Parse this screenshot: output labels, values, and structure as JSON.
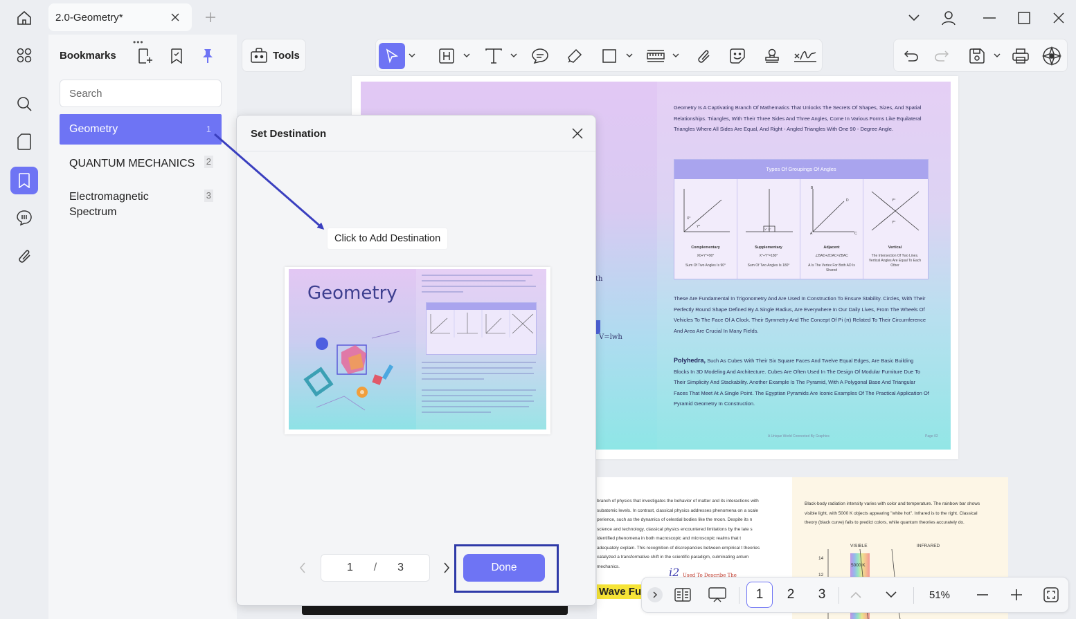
{
  "window": {
    "tab_title": "2.0-Geometry*"
  },
  "bookmarks": {
    "title": "Bookmarks",
    "search_placeholder": "Search",
    "items": [
      {
        "label": "Geometry",
        "page": "1",
        "selected": true
      },
      {
        "label": "QUANTUM MECHANICS",
        "page": "2",
        "selected": false
      },
      {
        "label": "Electromagnetic",
        "label2": "Spectrum",
        "page": "3",
        "selected": false
      }
    ]
  },
  "toolbar": {
    "tools_label": "Tools"
  },
  "dialog": {
    "title": "Set Destination",
    "tooltip": "Click to Add Destination",
    "current_page": "1",
    "separator": "/",
    "total_pages": "3",
    "done_label": "Done",
    "preview": {
      "title": "Geometry"
    }
  },
  "document": {
    "page1": {
      "intro": "Geometry Is A Captivating Branch Of Mathematics That Unlocks The Secrets Of Shapes, Sizes, And Spatial Relationships. Triangles, With Their Three Sides And Three Angles, Come In Various Forms Like Equilateral Triangles Where All Sides Are Equal, And Right - Angled Triangles With One 90 - Degree Angle.",
      "table_title": "Types Of Groupings Of Angles",
      "angles": [
        {
          "name": "Complementary",
          "desc": "X0+Y°=90°",
          "desc2": "Sum Of Two Angles Is 90°"
        },
        {
          "name": "Supplementary",
          "desc": "X°+Y°=180°",
          "desc2": "Sum Of Two Angles Is 180°"
        },
        {
          "name": "Adjacent",
          "desc": "∠BAD+ZDAC=ZBAC",
          "desc2": "A Is The Vertex For Both AD Is Shared"
        },
        {
          "name": "Vertical",
          "desc": "The Intersection Of Two Lines. Vertical Angles Are Equal To Each Other",
          "desc2": ""
        }
      ],
      "para2": "These Are Fundamental In Trigonometry And Are Used In Construction To Ensure Stability. Circles, With Their Perfectly Round Shape Defined By A Single Radius, Are Everywhere In Our Daily Lives, From The Wheels Of Vehicles To The Face Of A Clock. Their Symmetry And The Concept Of Pi (π) Related To Their Circumference And Area Are Crucial In Many Fields.",
      "poly_bold": "Polyhedra,",
      "para3": " Such As Cubes With Their Six Square Faces And Twelve Equal Edges, Are Basic Building Blocks In 3D Modeling And Architecture. Cubes Are Often Used In The Design Of Modular Furniture Due To Their Simplicity And Stackability. Another Example Is The Pyramid, With A Polygonal Base And Triangular Faces That Meet At A Single Point. The Egyptian Pyramids Are Iconic Examples Of The Practical Application Of Pyramid Geometry In Construction.",
      "footer_left": "A Unique World Connected By Graphics",
      "footer_right": "Page 02",
      "behind_text_1": "th",
      "behind_text_2": "V=lwh"
    },
    "page2": {
      "left_text": "branch of physics that investigates the behavior of matter and its interactions with subatomic levels. In contrast, classical physics addresses phenomena on a scale perience, such as the dynamics of celestial bodies like the moon. Despite its n science and technology, classical physics encountered limitations by the late s identified phenomena in both macroscopic and microscopic realms that t adequately explain. This recognition of discrepancies between empirical t theories catalyzed a transformative shift in the scientific paradigm, culminating antum mechanics.",
      "right_text": "Black-body radiation intensity varies with color and temperature. The rainbow bar shows visible light, with 5000 K objects appearing \"white hot\". Infrared is to the right. Classical theory (black curve) fails to predict colors, while quantum theories accurately do.",
      "visible": "VISIBLE",
      "infrared": "INFRARED",
      "k5000": "5000 K",
      "tick14": "14",
      "tick12": "12",
      "i2": "i2",
      "used": "Used To Describe The",
      "wave_tag": "Wave Fur"
    }
  },
  "pagenav": {
    "pages": [
      "1",
      "2",
      "3"
    ],
    "zoom": "51%"
  },
  "colors": {
    "accent": "#6e74f4",
    "highlight_outline": "#2f3aa8"
  }
}
